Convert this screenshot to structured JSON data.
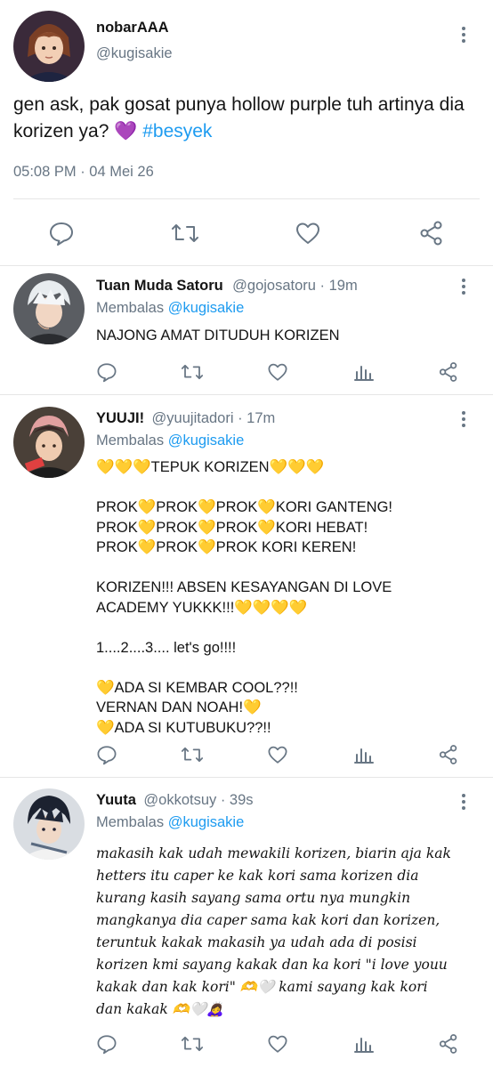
{
  "main_tweet": {
    "name": "nobarAAA",
    "handle": "@kugisakie",
    "text": "gen ask, pak gosat punya hollow purple tuh artinya dia korizen ya? 💜 ",
    "hashtag": "#besyek",
    "timestamp": "05:08 PM · 04 Mei 26",
    "actions": [
      "reply-icon",
      "retweet-icon",
      "like-icon",
      "share-icon"
    ]
  },
  "replies": [
    {
      "name": "Tuan Muda Satoru",
      "handle": "@gojosatoru · 19m",
      "replying_prefix": "Membalas",
      "replying_to": "@kugisakie",
      "text": "NAJONG AMAT DITUDUH KORIZEN"
    },
    {
      "name": "YUUJI!",
      "handle": "@yuujitadori · 17m",
      "replying_prefix": "Membalas",
      "replying_to": "@kugisakie",
      "text": "💛💛💛TEPUK KORIZEN💛💛💛\n\nPROK💛PROK💛PROK💛KORI GANTENG!\nPROK💛PROK💛PROK💛KORI HEBAT!\nPROK💛PROK💛PROK KORI KEREN!\n\nKORIZEN!!! ABSEN KESAYANGAN DI LOVE\nACADEMY YUKKK!!!💛💛💛💛\n\n1....2....3.... let's go!!!!\n\n💛ADA SI KEMBAR COOL??!!\nVERNAN DAN NOAH!💛\n💛ADA SI KUTUBUKU??!!"
    },
    {
      "name": "Yuuta",
      "handle": "@okkotsuy · 39s",
      "replying_prefix": "Membalas",
      "replying_to": "@kugisakie",
      "text": "makasih kak udah mewakili korizen, biarin aja kak\nhetters itu caper ke kak kori sama korizen dia\nkurang kasih sayang sama ortu nya mungkin\nmangkanya dia caper sama kak kori dan korizen,\nteruntuk kakak makasih ya udah ada di posisi\nkorizen kmi sayang kakak dan ka kori \"i love youu\nkakak dan kak kori\" 🫶🤍 kami sayang kak kori\ndan kakak 🫶🤍🙇‍♀️"
    }
  ],
  "colors": {
    "accent": "#1d9bf0",
    "secondary_text": "#687684",
    "divider": "#e6e6e6"
  }
}
